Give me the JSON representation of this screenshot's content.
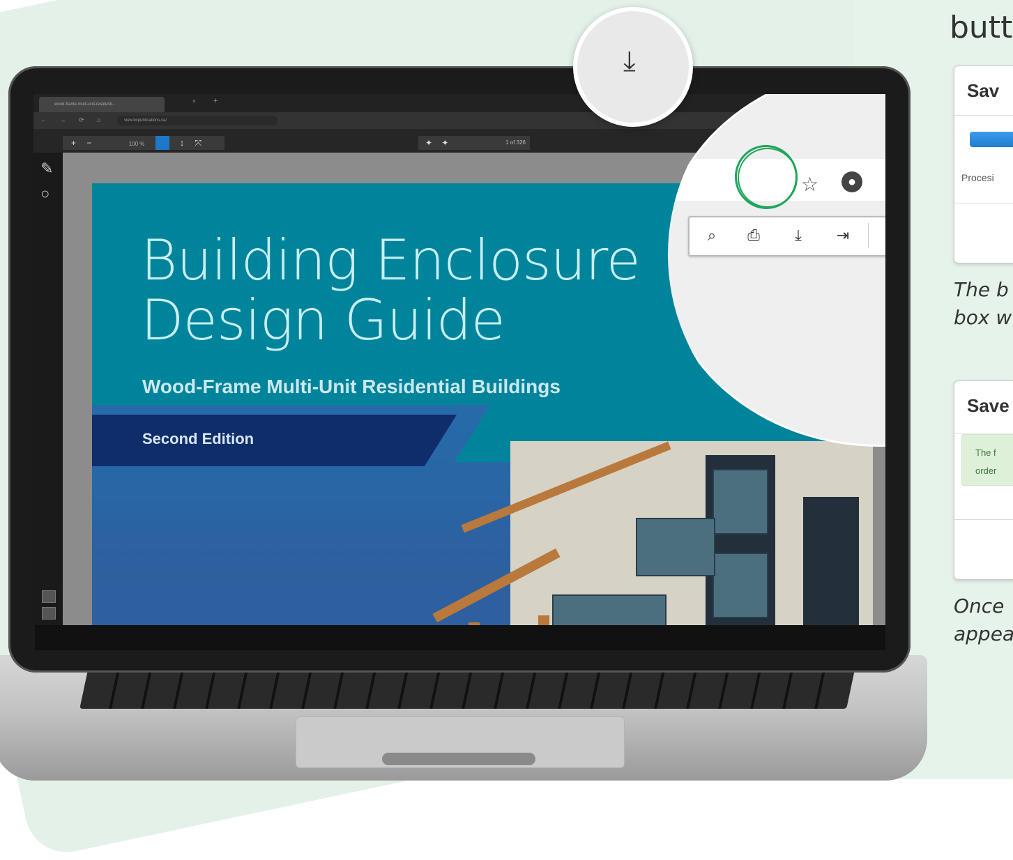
{
  "side_panel": {
    "heading": "butt",
    "dialog_1": {
      "title": "Sav",
      "status_text": "Procesi"
    },
    "caption_1": {
      "line1": "The b",
      "line2": "box w"
    },
    "dialog_2": {
      "title": "Save",
      "success_line1": "The f",
      "success_line2": "order"
    },
    "caption_2": {
      "line1": "Once",
      "line2": "appea"
    }
  },
  "browser": {
    "tab_title": "wood-frame-multi-unit-residenti...",
    "tab_close": "×",
    "new_tab": "+",
    "url": "view.bcpublications.ca/",
    "nav_icons": "← → ⟳ ⌂"
  },
  "pdf_toolbar": {
    "zoom_value": "100 %",
    "page_indicator": "1 of 326"
  },
  "document": {
    "title_line1": "Building Enclosure",
    "title_line2": "Design Guide",
    "subtitle": "Wood-Frame Multi-Unit Residential Buildings",
    "edition": "Second Edition"
  },
  "icons": {
    "download": "download-icon",
    "search": "search-icon",
    "print": "print-icon",
    "exit": "exit-icon",
    "menu": "hamburger-menu-icon",
    "star": "star-icon",
    "account": "account-icon",
    "more": "more-vertical-icon",
    "pencil": "pencil-icon",
    "comment": "comment-icon"
  },
  "colors": {
    "accent_green": "#1fa65a",
    "teal": "#00849b",
    "navy": "#0f2d6b",
    "progress_blue": "#1d7ed4"
  }
}
